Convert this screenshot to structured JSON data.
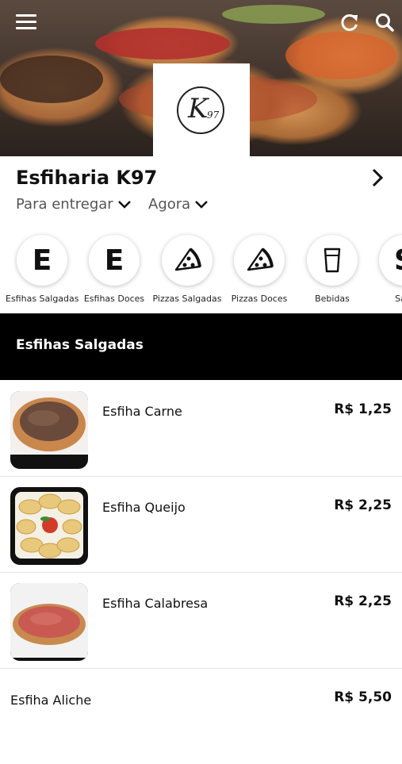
{
  "header": {
    "menu_icon": "hamburger-menu-icon",
    "refresh_icon": "refresh-icon",
    "search_icon": "search-icon",
    "logo_text_main": "K",
    "logo_text_sub": "97"
  },
  "store": {
    "name": "Esfiharia K97",
    "delivery_option": "Para entregar",
    "time_option": "Agora"
  },
  "categories": [
    {
      "label": "Esfihas Salgadas",
      "glyph": "E"
    },
    {
      "label": "Esfihas Doces",
      "glyph": "E"
    },
    {
      "label": "Pizzas Salgadas",
      "glyph": "",
      "icon": "pizza-slice-icon"
    },
    {
      "label": "Pizzas Doces",
      "glyph": "",
      "icon": "pizza-slice-icon"
    },
    {
      "label": "Bebidas",
      "glyph": "",
      "icon": "drink-cup-icon"
    },
    {
      "label": "Salg",
      "glyph": "S"
    }
  ],
  "section": {
    "title": "Esfihas Salgadas"
  },
  "products": [
    {
      "name": "Esfiha Carne",
      "price": "R$ 1,25"
    },
    {
      "name": "Esfiha Queijo",
      "price": "R$ 2,25"
    },
    {
      "name": "Esfiha Calabresa",
      "price": "R$ 2,25"
    },
    {
      "name": "Esfiha Aliche",
      "price": "R$ 5,50"
    }
  ],
  "colors": {
    "section_bar": "#000000",
    "text": "#111111",
    "muted": "#555555"
  }
}
